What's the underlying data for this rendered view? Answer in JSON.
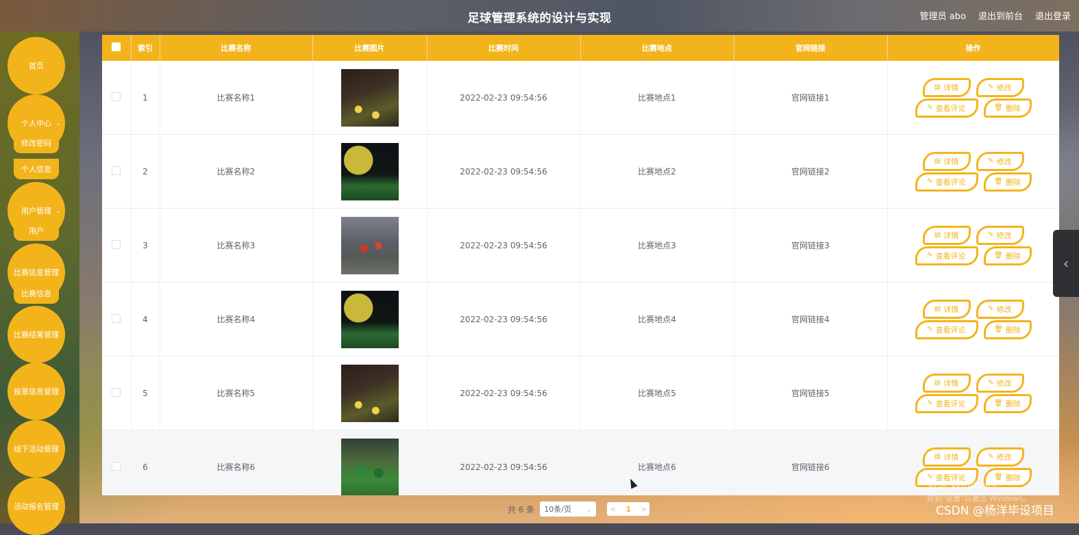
{
  "header": {
    "title": "足球管理系统的设计与实现",
    "user": "管理员 abo",
    "to_front": "退出到前台",
    "logout": "退出登录"
  },
  "sidebar": {
    "home": "首页",
    "personal": "个人中心",
    "personal_sub": [
      "修改密码",
      "个人信息"
    ],
    "users": "用户管理",
    "users_sub": [
      "用户"
    ],
    "match": "比赛信息管理",
    "match_sub": [
      "比赛信息"
    ],
    "result": "比赛结果管理",
    "vote": "投票信息管理",
    "offline": "线下活动管理",
    "signup": "活动报名管理"
  },
  "table": {
    "headers": [
      "索引",
      "比赛名称",
      "比赛图片",
      "比赛时间",
      "比赛地点",
      "官网链接",
      "操作"
    ],
    "rows": [
      {
        "index": "1",
        "name": "比赛名称1",
        "time": "2022-02-23 09:54:56",
        "place": "比赛地点1",
        "link": "官网链接1"
      },
      {
        "index": "2",
        "name": "比赛名称2",
        "time": "2022-02-23 09:54:56",
        "place": "比赛地点2",
        "link": "官网链接2"
      },
      {
        "index": "3",
        "name": "比赛名称3",
        "time": "2022-02-23 09:54:56",
        "place": "比赛地点3",
        "link": "官网链接3"
      },
      {
        "index": "4",
        "name": "比赛名称4",
        "time": "2022-02-23 09:54:56",
        "place": "比赛地点4",
        "link": "官网链接4"
      },
      {
        "index": "5",
        "name": "比赛名称5",
        "time": "2022-02-23 09:54:56",
        "place": "比赛地点5",
        "link": "官网链接5"
      },
      {
        "index": "6",
        "name": "比赛名称6",
        "time": "2022-02-23 09:54:56",
        "place": "比赛地点6",
        "link": "官网链接6"
      }
    ],
    "actions": {
      "detail": "详情",
      "edit": "修改",
      "comments": "查看评论",
      "delete": "删除"
    }
  },
  "pager": {
    "total": "共 6 条",
    "page_size": "10条/页",
    "current": "1"
  },
  "watermark": {
    "line1": "激活 Windows",
    "line2": "转到\"设置\"以激活 Windows。"
  },
  "credit": "CSDN @杨洋毕设项目",
  "accent": "#f3b41b"
}
